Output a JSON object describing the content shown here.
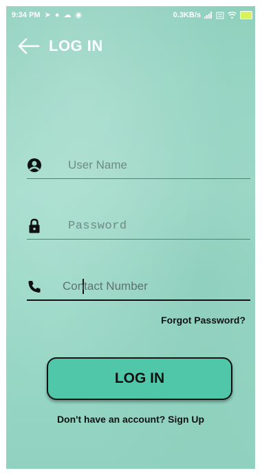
{
  "status_bar": {
    "time": "9:34 PM",
    "network_speed": "0.3KB/s",
    "battery_color": "#d6f35a"
  },
  "app_bar": {
    "title": "LOG IN",
    "back_icon": "arrow-left-icon"
  },
  "form": {
    "username": {
      "placeholder": "User Name",
      "icon": "account-circle-icon"
    },
    "password": {
      "placeholder": "Password",
      "icon": "lock-icon"
    },
    "contact": {
      "placeholder": "Contact Number",
      "icon": "phone-icon"
    },
    "forgot_label": "Forgot Password?",
    "login_label": "LOG IN",
    "signup_label": "Don't have an account? Sign Up"
  },
  "colors": {
    "background": "#9ad8c6",
    "button": "#4fc7a8",
    "text": "#111111"
  }
}
